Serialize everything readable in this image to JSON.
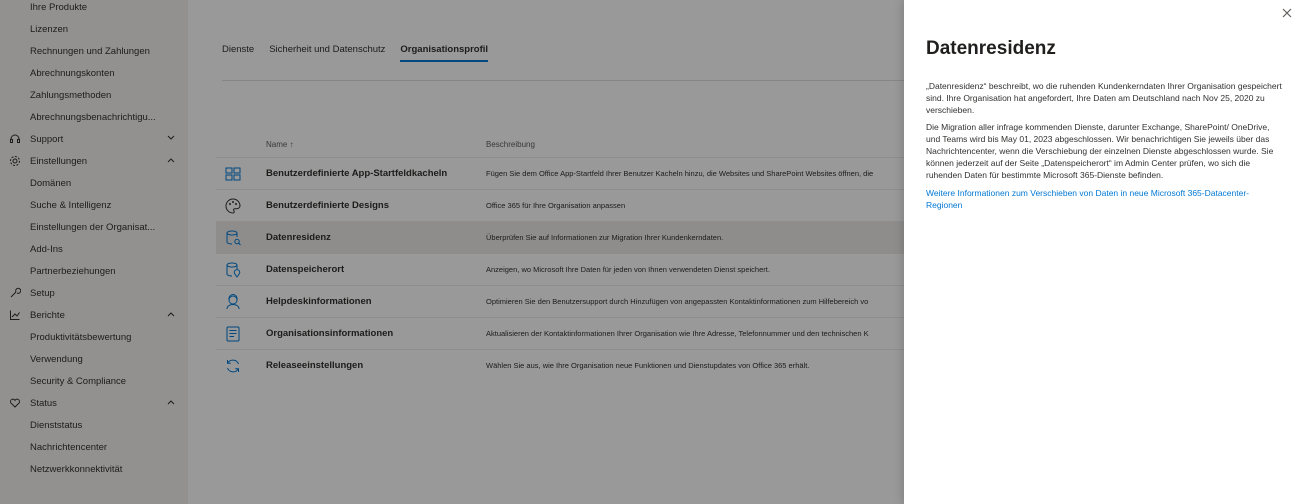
{
  "sidebar": {
    "items": [
      {
        "label": "Ihre Produkte",
        "type": "sub"
      },
      {
        "label": "Lizenzen",
        "type": "sub"
      },
      {
        "label": "Rechnungen und Zahlungen",
        "type": "sub"
      },
      {
        "label": "Abrechnungskonten",
        "type": "sub"
      },
      {
        "label": "Zahlungsmethoden",
        "type": "sub"
      },
      {
        "label": "Abrechnungsbenachrichtigu...",
        "type": "sub"
      },
      {
        "label": "Support",
        "type": "top",
        "icon": "headset-icon",
        "chevron": "down"
      },
      {
        "label": "Einstellungen",
        "type": "top",
        "icon": "gear-icon",
        "chevron": "up"
      },
      {
        "label": "Domänen",
        "type": "sub"
      },
      {
        "label": "Suche & Intelligenz",
        "type": "sub"
      },
      {
        "label": "Einstellungen der Organisat...",
        "type": "sub"
      },
      {
        "label": "Add-Ins",
        "type": "sub"
      },
      {
        "label": "Partnerbeziehungen",
        "type": "sub"
      },
      {
        "label": "Setup",
        "type": "top",
        "icon": "wrench-icon"
      },
      {
        "label": "Berichte",
        "type": "top",
        "icon": "chart-icon",
        "chevron": "up"
      },
      {
        "label": "Produktivitätsbewertung",
        "type": "sub"
      },
      {
        "label": "Verwendung",
        "type": "sub"
      },
      {
        "label": "Security & Compliance",
        "type": "sub"
      },
      {
        "label": "Status",
        "type": "top",
        "icon": "heart-icon",
        "chevron": "up"
      },
      {
        "label": "Dienststatus",
        "type": "sub"
      },
      {
        "label": "Nachrichtencenter",
        "type": "sub"
      },
      {
        "label": "Netzwerkkonnektivität",
        "type": "sub"
      }
    ]
  },
  "tabs": [
    {
      "label": "Dienste",
      "active": false
    },
    {
      "label": "Sicherheit und Datenschutz",
      "active": false
    },
    {
      "label": "Organisationsprofil",
      "active": true
    }
  ],
  "table": {
    "col_name": "Name ↑",
    "col_desc": "Beschreibung",
    "rows": [
      {
        "name": "Benutzerdefinierte App-Startfeldkacheln",
        "desc": "Fügen Sie dem Office App-Startfeld Ihrer Benutzer Kacheln hinzu, die Websites und SharePoint Websites öffnen, die",
        "icon": "app-tiles-icon"
      },
      {
        "name": "Benutzerdefinierte Designs",
        "desc": "Office 365 für Ihre Organisation anpassen",
        "icon": "palette-icon"
      },
      {
        "name": "Datenresidenz",
        "desc": "Überprüfen Sie auf Informationen zur Migration Ihrer Kundenkerndaten.",
        "icon": "database-search-icon",
        "selected": true
      },
      {
        "name": "Datenspeicherort",
        "desc": "Anzeigen, wo Microsoft Ihre Daten für jeden von Ihnen verwendeten Dienst speichert.",
        "icon": "database-location-icon"
      },
      {
        "name": "Helpdeskinformationen",
        "desc": "Optimieren Sie den Benutzersupport durch Hinzufügen von angepassten Kontaktinformationen zum Hilfebereich vo",
        "icon": "helpdesk-icon"
      },
      {
        "name": "Organisationsinformationen",
        "desc": "Aktualisieren der Kontaktinformationen Ihrer Organisation wie Ihre Adresse, Telefonnummer und den technischen K",
        "icon": "org-info-icon"
      },
      {
        "name": "Releaseeinstellungen",
        "desc": "Wählen Sie aus, wie Ihre Organisation neue Funktionen und Dienstupdates von Office 365 erhält.",
        "icon": "refresh-icon"
      }
    ]
  },
  "panel": {
    "title": "Datenresidenz",
    "close_glyph": "×",
    "para1": "„Datenresidenz“ beschreibt, wo die ruhenden Kundenkerndaten Ihrer Organisation gespeichert sind. Ihre Organisation hat angefordert, Ihre Daten am Deutschland nach Nov 25, 2020 zu verschieben.",
    "para2": "Die Migration aller infrage kommenden Dienste, darunter Exchange, SharePoint/ OneDrive, und Teams wird bis May 01, 2023 abgeschlossen. Wir benachrichtigen Sie jeweils über das Nachrichtencenter, wenn die Verschiebung der einzelnen Dienste abgeschlossen wurde. Sie können jederzeit auf der Seite „Datenspeicherort“ im Admin Center prüfen, wo sich die ruhenden Daten für bestimmte Microsoft 365-Dienste befinden.",
    "link": "Weitere Informationen zum Verschieben von Daten in neue Microsoft 365-Datacenter-Regionen"
  },
  "colors": {
    "accent": "#0078d4",
    "overlay": "rgba(0,0,0,0.40)",
    "sidebar_bg": "#f3f2f1"
  }
}
